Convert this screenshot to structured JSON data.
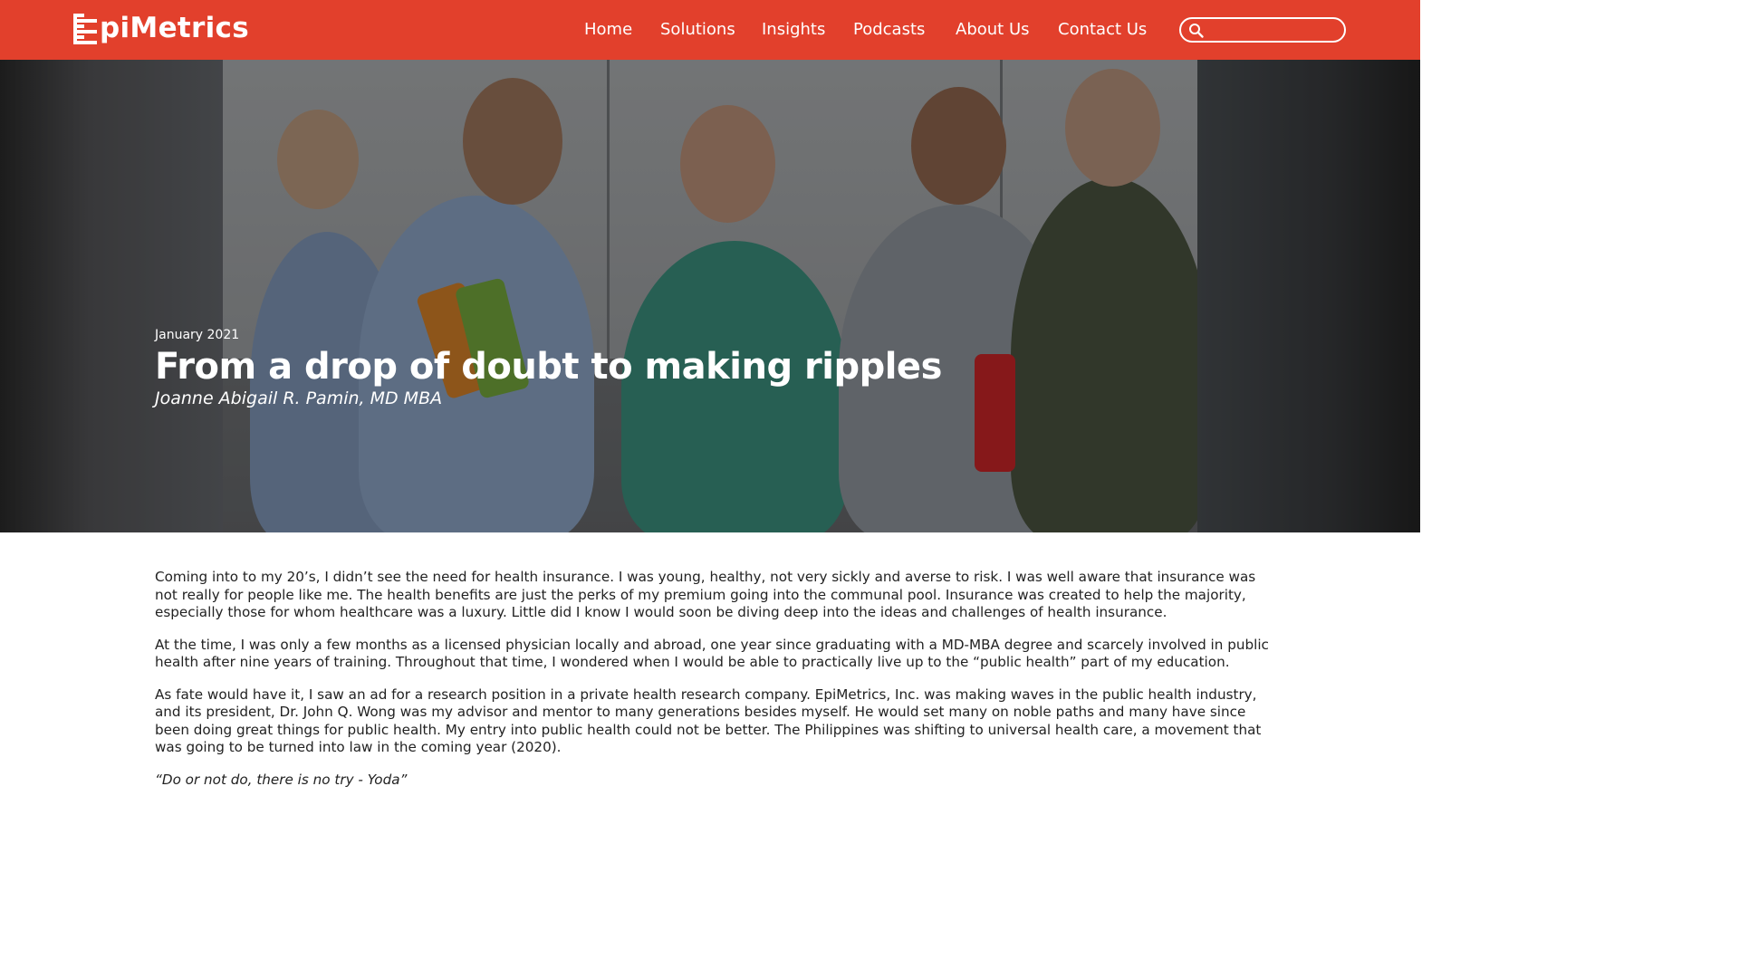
{
  "nav": {
    "logo_text": "piMetrics",
    "brand_color": "#e2402c",
    "items": [
      {
        "label": "Home"
      },
      {
        "label": "Solutions"
      },
      {
        "label": "Insights"
      },
      {
        "label": "Podcasts"
      },
      {
        "label": "About Us"
      },
      {
        "label": "Contact Us"
      }
    ],
    "search": {
      "placeholder": "",
      "icon": "search-icon"
    }
  },
  "hero": {
    "date": "January 2021",
    "title": "From a drop of doubt to making ripples",
    "author": "Joanne Abigail R. Pamin, MD MBA"
  },
  "article": {
    "paragraphs": [
      "Coming into to my 20’s, I didn’t see the need for health insurance. I was young, healthy, not very sickly and averse to risk. I was well aware that insurance was not really for people like me. The health benefits are just the perks of my premium going into the communal pool. Insurance was created to help the majority, especially those for whom healthcare was a luxury. Little did I know I would soon be diving deep into the ideas and challenges of health insurance.",
      "At the time, I was only a few months as a licensed physician locally and abroad, one year since graduating with a MD-MBA degree and scarcely involved in public health after nine years of training. Throughout that time, I wondered when I would be able to practically live up to the “public health” part of my education.",
      "As fate would have it, I saw an ad for a research position in a private health research company. EpiMetrics, Inc. was making waves in the public health industry, and its president, Dr. John Q. Wong was my advisor and mentor to many generations besides myself. He would set many on noble paths and many have since been doing great things for public health. My entry into public health could not be better. The Philippines was shifting to universal health care, a movement that was going to be turned into law in the coming year (2020).",
      "“Do or not do, there is no try - Yoda”"
    ]
  }
}
